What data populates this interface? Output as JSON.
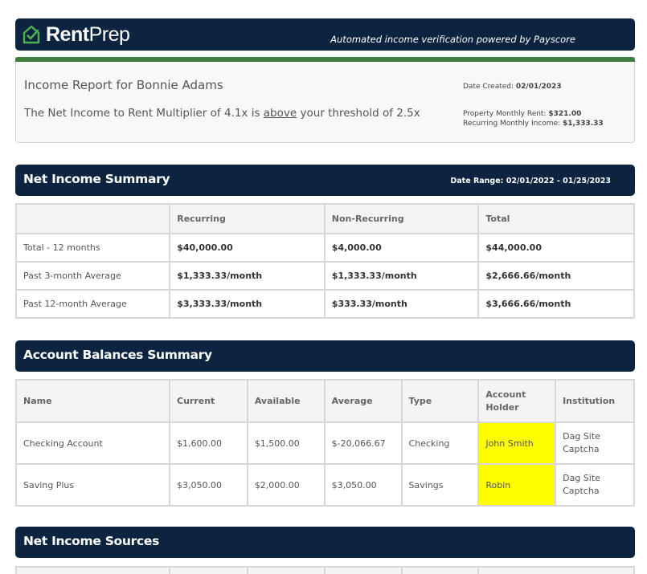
{
  "banner": {
    "logo_rent": "Rent",
    "logo_prep": "Prep",
    "tagline": "Automated income verification powered by Payscore"
  },
  "report": {
    "title": "Income Report for Bonnie Adams",
    "statement_prefix": "The Net Income to Rent Multiplier of 4.1x is ",
    "statement_emph": "above",
    "statement_suffix": " your threshold of 2.5x",
    "date_created_label": "Date Created:",
    "date_created_value": "02/01/2023",
    "rent_label": "Property Monthly Rent:",
    "rent_value": "$321.00",
    "income_label": "Recurring Monthly Income:",
    "income_value": "$1,333.33"
  },
  "net_income_summary": {
    "title": "Net Income Summary",
    "date_range_label": "Date Range:",
    "date_range_value": "02/01/2022 - 01/25/2023",
    "columns": [
      "",
      "Recurring",
      "Non-Recurring",
      "Total"
    ],
    "rows": [
      {
        "label": "Total - 12 months",
        "recurring": "$40,000.00",
        "non_recurring": "$4,000.00",
        "total": "$44,000.00"
      },
      {
        "label": "Past 3-month Average",
        "recurring": "$1,333.33/month",
        "non_recurring": "$1,333.33/month",
        "total": "$2,666.66/month"
      },
      {
        "label": "Past 12-month Average",
        "recurring": "$3,333.33/month",
        "non_recurring": "$333.33/month",
        "total": "$3,666.66/month"
      }
    ]
  },
  "account_balances": {
    "title": "Account Balances Summary",
    "columns": [
      "Name",
      "Current",
      "Available",
      "Average",
      "Type",
      "Account Holder",
      "Institution"
    ],
    "rows": [
      {
        "name": "Checking Account",
        "current": "$1,600.00",
        "available": "$1,500.00",
        "average": "$-20,066.67",
        "type": "Checking",
        "holder": "John Smith",
        "institution": "Dag Site Captcha"
      },
      {
        "name": "Saving Plus",
        "current": "$3,050.00",
        "available": "$2,000.00",
        "average": "$3,050.00",
        "type": "Savings",
        "holder": "Robin",
        "institution": "Dag Site Captcha"
      }
    ]
  },
  "net_income_sources": {
    "title": "Net Income Sources"
  },
  "colors": {
    "navy": "#0c2440",
    "green": "#3e7e3e",
    "highlight": "#ffff00"
  },
  "icons": {
    "logo": "house-check-icon"
  }
}
